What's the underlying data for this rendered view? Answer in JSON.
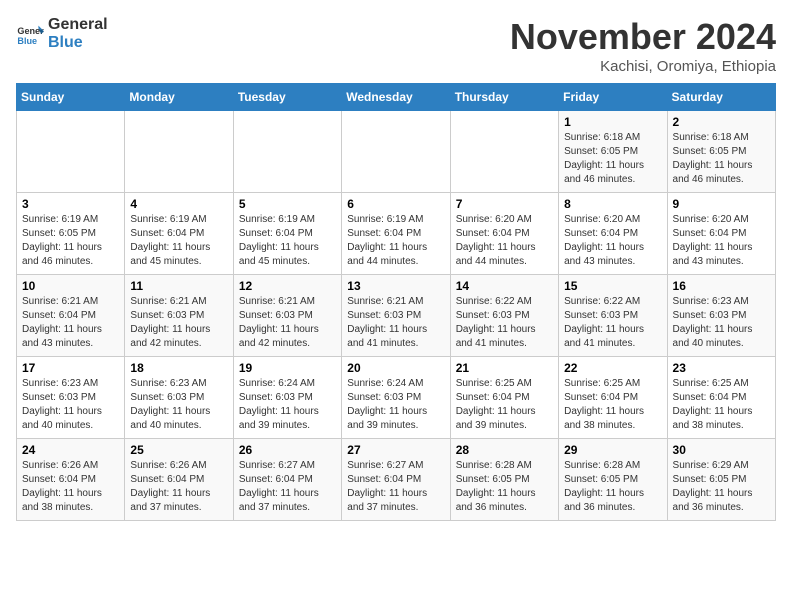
{
  "header": {
    "logo_line1": "General",
    "logo_line2": "Blue",
    "month_title": "November 2024",
    "location": "Kachisi, Oromiya, Ethiopia"
  },
  "days_of_week": [
    "Sunday",
    "Monday",
    "Tuesday",
    "Wednesday",
    "Thursday",
    "Friday",
    "Saturday"
  ],
  "weeks": [
    [
      {
        "num": "",
        "info": ""
      },
      {
        "num": "",
        "info": ""
      },
      {
        "num": "",
        "info": ""
      },
      {
        "num": "",
        "info": ""
      },
      {
        "num": "",
        "info": ""
      },
      {
        "num": "1",
        "info": "Sunrise: 6:18 AM\nSunset: 6:05 PM\nDaylight: 11 hours and 46 minutes."
      },
      {
        "num": "2",
        "info": "Sunrise: 6:18 AM\nSunset: 6:05 PM\nDaylight: 11 hours and 46 minutes."
      }
    ],
    [
      {
        "num": "3",
        "info": "Sunrise: 6:19 AM\nSunset: 6:05 PM\nDaylight: 11 hours and 46 minutes."
      },
      {
        "num": "4",
        "info": "Sunrise: 6:19 AM\nSunset: 6:04 PM\nDaylight: 11 hours and 45 minutes."
      },
      {
        "num": "5",
        "info": "Sunrise: 6:19 AM\nSunset: 6:04 PM\nDaylight: 11 hours and 45 minutes."
      },
      {
        "num": "6",
        "info": "Sunrise: 6:19 AM\nSunset: 6:04 PM\nDaylight: 11 hours and 44 minutes."
      },
      {
        "num": "7",
        "info": "Sunrise: 6:20 AM\nSunset: 6:04 PM\nDaylight: 11 hours and 44 minutes."
      },
      {
        "num": "8",
        "info": "Sunrise: 6:20 AM\nSunset: 6:04 PM\nDaylight: 11 hours and 43 minutes."
      },
      {
        "num": "9",
        "info": "Sunrise: 6:20 AM\nSunset: 6:04 PM\nDaylight: 11 hours and 43 minutes."
      }
    ],
    [
      {
        "num": "10",
        "info": "Sunrise: 6:21 AM\nSunset: 6:04 PM\nDaylight: 11 hours and 43 minutes."
      },
      {
        "num": "11",
        "info": "Sunrise: 6:21 AM\nSunset: 6:03 PM\nDaylight: 11 hours and 42 minutes."
      },
      {
        "num": "12",
        "info": "Sunrise: 6:21 AM\nSunset: 6:03 PM\nDaylight: 11 hours and 42 minutes."
      },
      {
        "num": "13",
        "info": "Sunrise: 6:21 AM\nSunset: 6:03 PM\nDaylight: 11 hours and 41 minutes."
      },
      {
        "num": "14",
        "info": "Sunrise: 6:22 AM\nSunset: 6:03 PM\nDaylight: 11 hours and 41 minutes."
      },
      {
        "num": "15",
        "info": "Sunrise: 6:22 AM\nSunset: 6:03 PM\nDaylight: 11 hours and 41 minutes."
      },
      {
        "num": "16",
        "info": "Sunrise: 6:23 AM\nSunset: 6:03 PM\nDaylight: 11 hours and 40 minutes."
      }
    ],
    [
      {
        "num": "17",
        "info": "Sunrise: 6:23 AM\nSunset: 6:03 PM\nDaylight: 11 hours and 40 minutes."
      },
      {
        "num": "18",
        "info": "Sunrise: 6:23 AM\nSunset: 6:03 PM\nDaylight: 11 hours and 40 minutes."
      },
      {
        "num": "19",
        "info": "Sunrise: 6:24 AM\nSunset: 6:03 PM\nDaylight: 11 hours and 39 minutes."
      },
      {
        "num": "20",
        "info": "Sunrise: 6:24 AM\nSunset: 6:03 PM\nDaylight: 11 hours and 39 minutes."
      },
      {
        "num": "21",
        "info": "Sunrise: 6:25 AM\nSunset: 6:04 PM\nDaylight: 11 hours and 39 minutes."
      },
      {
        "num": "22",
        "info": "Sunrise: 6:25 AM\nSunset: 6:04 PM\nDaylight: 11 hours and 38 minutes."
      },
      {
        "num": "23",
        "info": "Sunrise: 6:25 AM\nSunset: 6:04 PM\nDaylight: 11 hours and 38 minutes."
      }
    ],
    [
      {
        "num": "24",
        "info": "Sunrise: 6:26 AM\nSunset: 6:04 PM\nDaylight: 11 hours and 38 minutes."
      },
      {
        "num": "25",
        "info": "Sunrise: 6:26 AM\nSunset: 6:04 PM\nDaylight: 11 hours and 37 minutes."
      },
      {
        "num": "26",
        "info": "Sunrise: 6:27 AM\nSunset: 6:04 PM\nDaylight: 11 hours and 37 minutes."
      },
      {
        "num": "27",
        "info": "Sunrise: 6:27 AM\nSunset: 6:04 PM\nDaylight: 11 hours and 37 minutes."
      },
      {
        "num": "28",
        "info": "Sunrise: 6:28 AM\nSunset: 6:05 PM\nDaylight: 11 hours and 36 minutes."
      },
      {
        "num": "29",
        "info": "Sunrise: 6:28 AM\nSunset: 6:05 PM\nDaylight: 11 hours and 36 minutes."
      },
      {
        "num": "30",
        "info": "Sunrise: 6:29 AM\nSunset: 6:05 PM\nDaylight: 11 hours and 36 minutes."
      }
    ]
  ]
}
